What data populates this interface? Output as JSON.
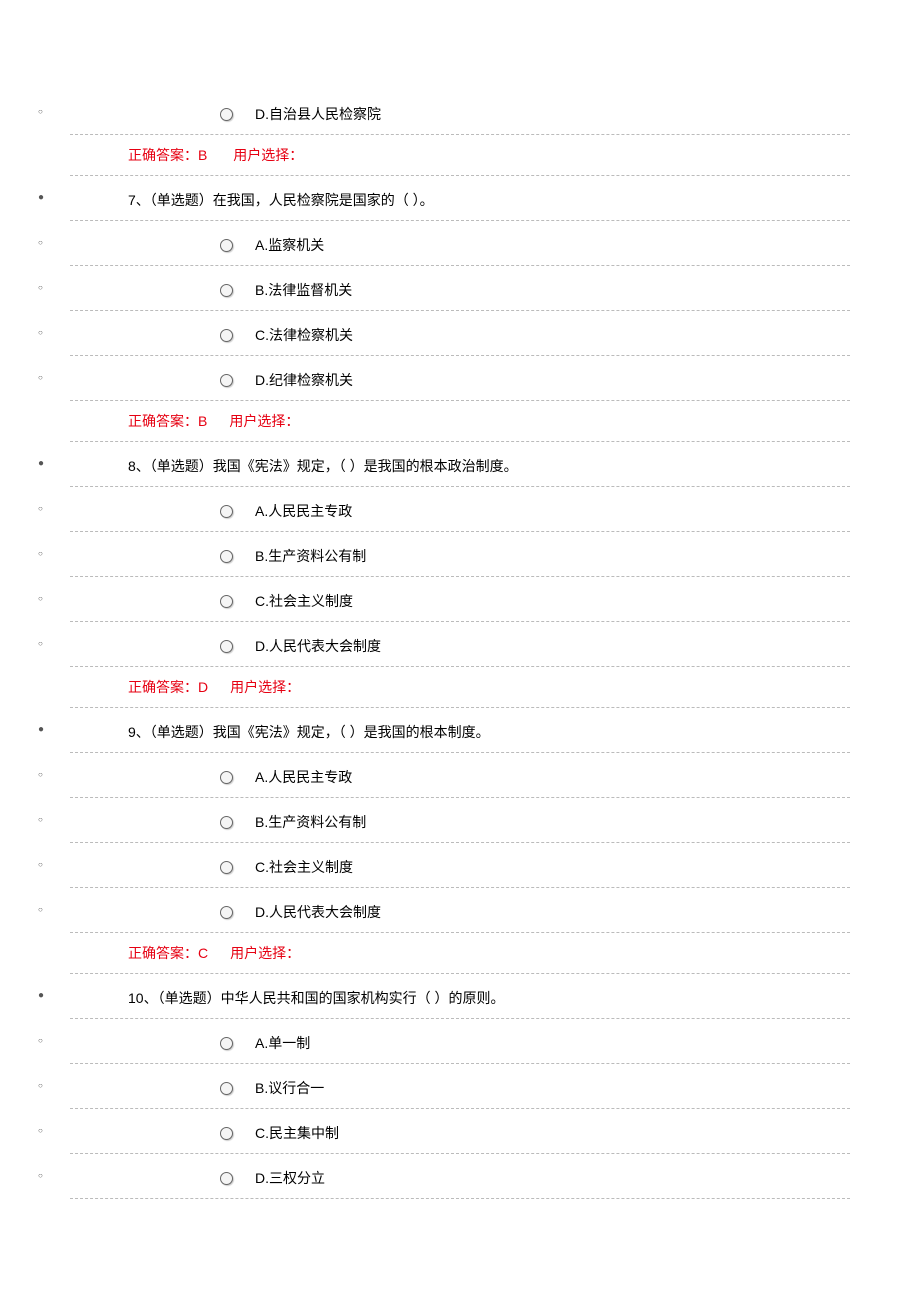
{
  "feedback_labels": {
    "correct_prefix": "正确答案：",
    "user_prefix": "用户选择："
  },
  "orphan_option": {
    "text": "D.自治县人民检察院"
  },
  "orphan_feedback": {
    "answer": "B"
  },
  "questions": [
    {
      "number": "7、",
      "text": "（单选题）在我国，人民检察院是国家的（  ）。",
      "options": [
        "A.监察机关",
        "B.法律监督机关",
        "C.法律检察机关",
        "D.纪律检察机关"
      ],
      "answer": "B"
    },
    {
      "number": "8、",
      "text": "（单选题）我国《宪法》规定，（  ）是我国的根本政治制度。",
      "options": [
        "A.人民民主专政",
        "B.生产资料公有制",
        "C.社会主义制度",
        "D.人民代表大会制度"
      ],
      "answer": "D"
    },
    {
      "number": "9、",
      "text": "（单选题）我国《宪法》规定，（  ）是我国的根本制度。",
      "options": [
        "A.人民民主专政",
        "B.生产资料公有制",
        "C.社会主义制度",
        "D.人民代表大会制度"
      ],
      "answer": "C"
    },
    {
      "number": "10、",
      "text": "（单选题）中华人民共和国的国家机构实行（  ）的原则。",
      "options": [
        "A.单一制",
        "B.议行合一",
        "C.民主集中制",
        "D.三权分立"
      ],
      "answer": null
    }
  ]
}
